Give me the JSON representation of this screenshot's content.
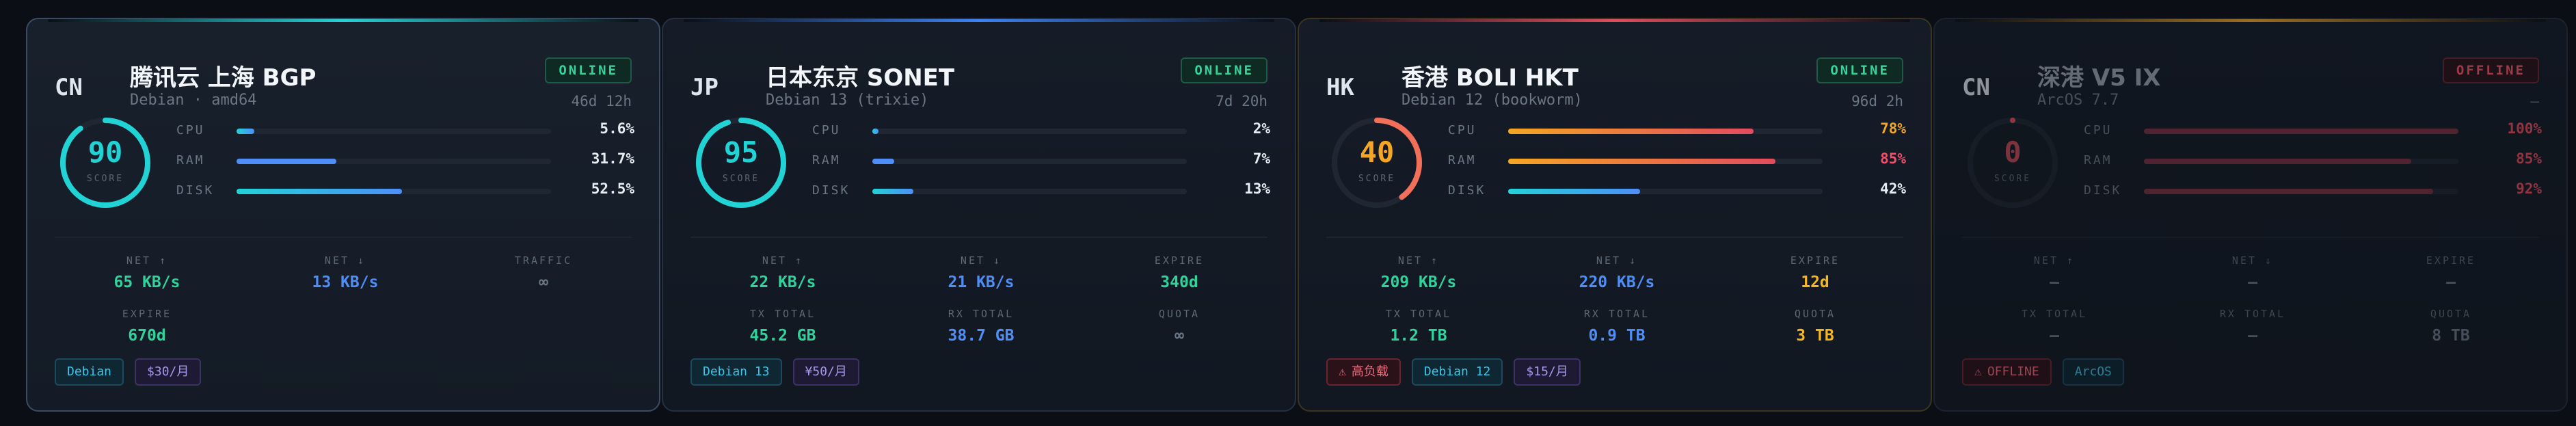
{
  "cards": [
    {
      "country": "CN",
      "name": "腾讯云 上海 BGP",
      "os": "Debian · amd64",
      "status": "ONLINE",
      "uptime": "46d 12h",
      "score": "90",
      "score_label": "SCORE",
      "score_color": "#22d3d6",
      "metrics": [
        {
          "label": "CPU",
          "value": "5.6%",
          "percent": 5.6
        },
        {
          "label": "RAM",
          "value": "31.7%",
          "percent": 31.7
        },
        {
          "label": "DISK",
          "value": "52.5%",
          "percent": 52.5
        }
      ],
      "stats": [
        {
          "label": "NET ↑",
          "value": "65 KB/s",
          "color": "#2fd49a"
        },
        {
          "label": "NET ↓",
          "value": "13 KB/s",
          "color": "#4f8ef7"
        },
        {
          "label": "TRAFFIC",
          "value": "∞",
          "color": "#6b7785"
        },
        {
          "label": "EXPIRE",
          "value": "670d",
          "color": "#2fd49a"
        }
      ],
      "tags": [
        {
          "type": "os-tag",
          "text": "Debian"
        },
        {
          "type": "price",
          "text": "$30/月"
        }
      ]
    },
    {
      "country": "JP",
      "name": "日本东京 SONET",
      "os": "Debian 13 (trixie)",
      "status": "ONLINE",
      "uptime": "7d 20h",
      "score": "95",
      "score_label": "SCORE",
      "score_color": "#22d3d6",
      "metrics": [
        {
          "label": "CPU",
          "value": "2%",
          "percent": 2
        },
        {
          "label": "RAM",
          "value": "7%",
          "percent": 7
        },
        {
          "label": "DISK",
          "value": "13%",
          "percent": 13
        }
      ],
      "stats": [
        {
          "label": "NET ↑",
          "value": "22 KB/s",
          "color": "#2fd49a"
        },
        {
          "label": "NET ↓",
          "value": "21 KB/s",
          "color": "#4f8ef7"
        },
        {
          "label": "EXPIRE",
          "value": "340d",
          "color": "#2fd49a"
        },
        {
          "label": "TX TOTAL",
          "value": "45.2 GB",
          "color": "#2fd49a"
        },
        {
          "label": "RX TOTAL",
          "value": "38.7 GB",
          "color": "#4f8ef7"
        },
        {
          "label": "QUOTA",
          "value": "∞",
          "color": "#6b7785"
        }
      ],
      "tags": [
        {
          "type": "os-tag",
          "text": "Debian 13"
        },
        {
          "type": "price",
          "text": "¥50/月"
        }
      ]
    },
    {
      "country": "HK",
      "name": "香港 BOLI HKT",
      "os": "Debian 12 (bookworm)",
      "status": "ONLINE",
      "uptime": "96d 2h",
      "score": "40",
      "score_label": "SCORE",
      "score_color": "#f5a623",
      "metrics": [
        {
          "label": "CPU",
          "value": "78%",
          "percent": 78
        },
        {
          "label": "RAM",
          "value": "85%",
          "percent": 85
        },
        {
          "label": "DISK",
          "value": "42%",
          "percent": 42
        }
      ],
      "stats": [
        {
          "label": "NET ↑",
          "value": "209 KB/s",
          "color": "#2fd49a"
        },
        {
          "label": "NET ↓",
          "value": "220 KB/s",
          "color": "#4f8ef7"
        },
        {
          "label": "EXPIRE",
          "value": "12d",
          "color": "#f5b623"
        },
        {
          "label": "TX TOTAL",
          "value": "1.2 TB",
          "color": "#2fd49a"
        },
        {
          "label": "RX TOTAL",
          "value": "0.9 TB",
          "color": "#4f8ef7"
        },
        {
          "label": "QUOTA",
          "value": "3 TB",
          "color": "#f5b623"
        }
      ],
      "tags": [
        {
          "type": "alert",
          "text": "高负载"
        },
        {
          "type": "os-tag",
          "text": "Debian 12"
        },
        {
          "type": "price",
          "text": "$15/月"
        }
      ]
    },
    {
      "country": "CN",
      "name": "深港 V5 IX",
      "os": "ArcOS 7.7",
      "status": "OFFLINE",
      "uptime": "—",
      "score": "0",
      "score_label": "SCORE",
      "score_color": "#e24b5e",
      "metrics": [
        {
          "label": "CPU",
          "value": "100%",
          "percent": 100
        },
        {
          "label": "RAM",
          "value": "85%",
          "percent": 85
        },
        {
          "label": "DISK",
          "value": "92%",
          "percent": 92
        }
      ],
      "stats": [
        {
          "label": "NET ↑",
          "value": "—",
          "color": "#6b7785"
        },
        {
          "label": "NET ↓",
          "value": "—",
          "color": "#6b7785"
        },
        {
          "label": "EXPIRE",
          "value": "—",
          "color": "#6b7785"
        },
        {
          "label": "TX TOTAL",
          "value": "—",
          "color": "#6b7785"
        },
        {
          "label": "RX TOTAL",
          "value": "—",
          "color": "#6b7785"
        },
        {
          "label": "QUOTA",
          "value": "8 TB",
          "color": "#6b7785"
        }
      ],
      "tags": [
        {
          "type": "alert",
          "text": "OFFLINE"
        },
        {
          "type": "os-tag",
          "text": "ArcOS"
        }
      ]
    }
  ],
  "colors": {
    "cyan": "#22d3d6",
    "green": "#2fd49a",
    "blue": "#4f8ef7",
    "orange": "#f5a623",
    "red": "#e24b5e",
    "track": "#1f2733"
  }
}
